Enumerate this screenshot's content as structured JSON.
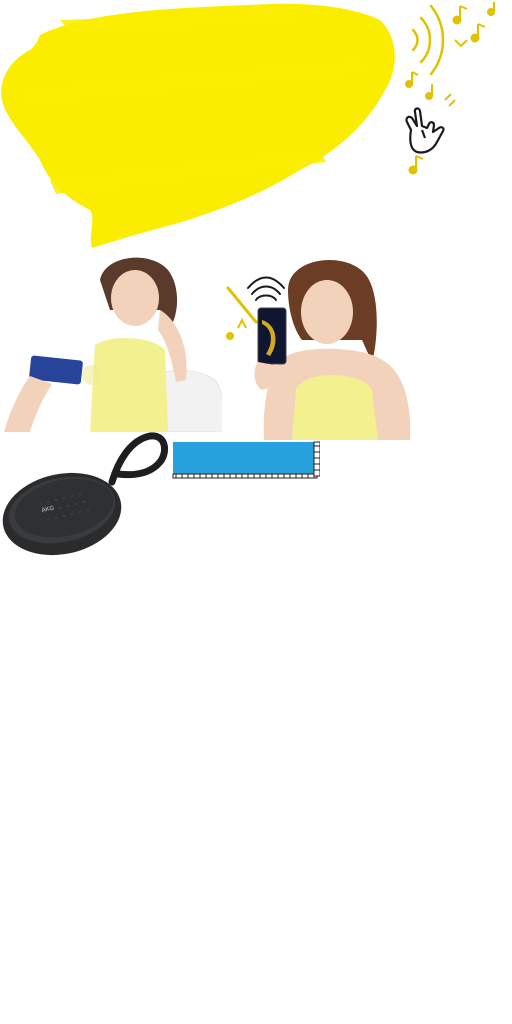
{
  "colors": {
    "brush_yellow": "#fbed00",
    "accent_blue": "#27a0de",
    "dress_yellow": "#f3f08f",
    "sofa_white": "#f4f4f4",
    "speaker_dark": "#2a2b2d",
    "note_gold": "#e1c200"
  },
  "icons": {
    "hand": "rock-on-hand-icon",
    "sound": "sound-waves-icon",
    "music": "music-notes-icon",
    "wifi": "wifi-signal-icon"
  },
  "speaker": {
    "logo_text": "AKG"
  }
}
